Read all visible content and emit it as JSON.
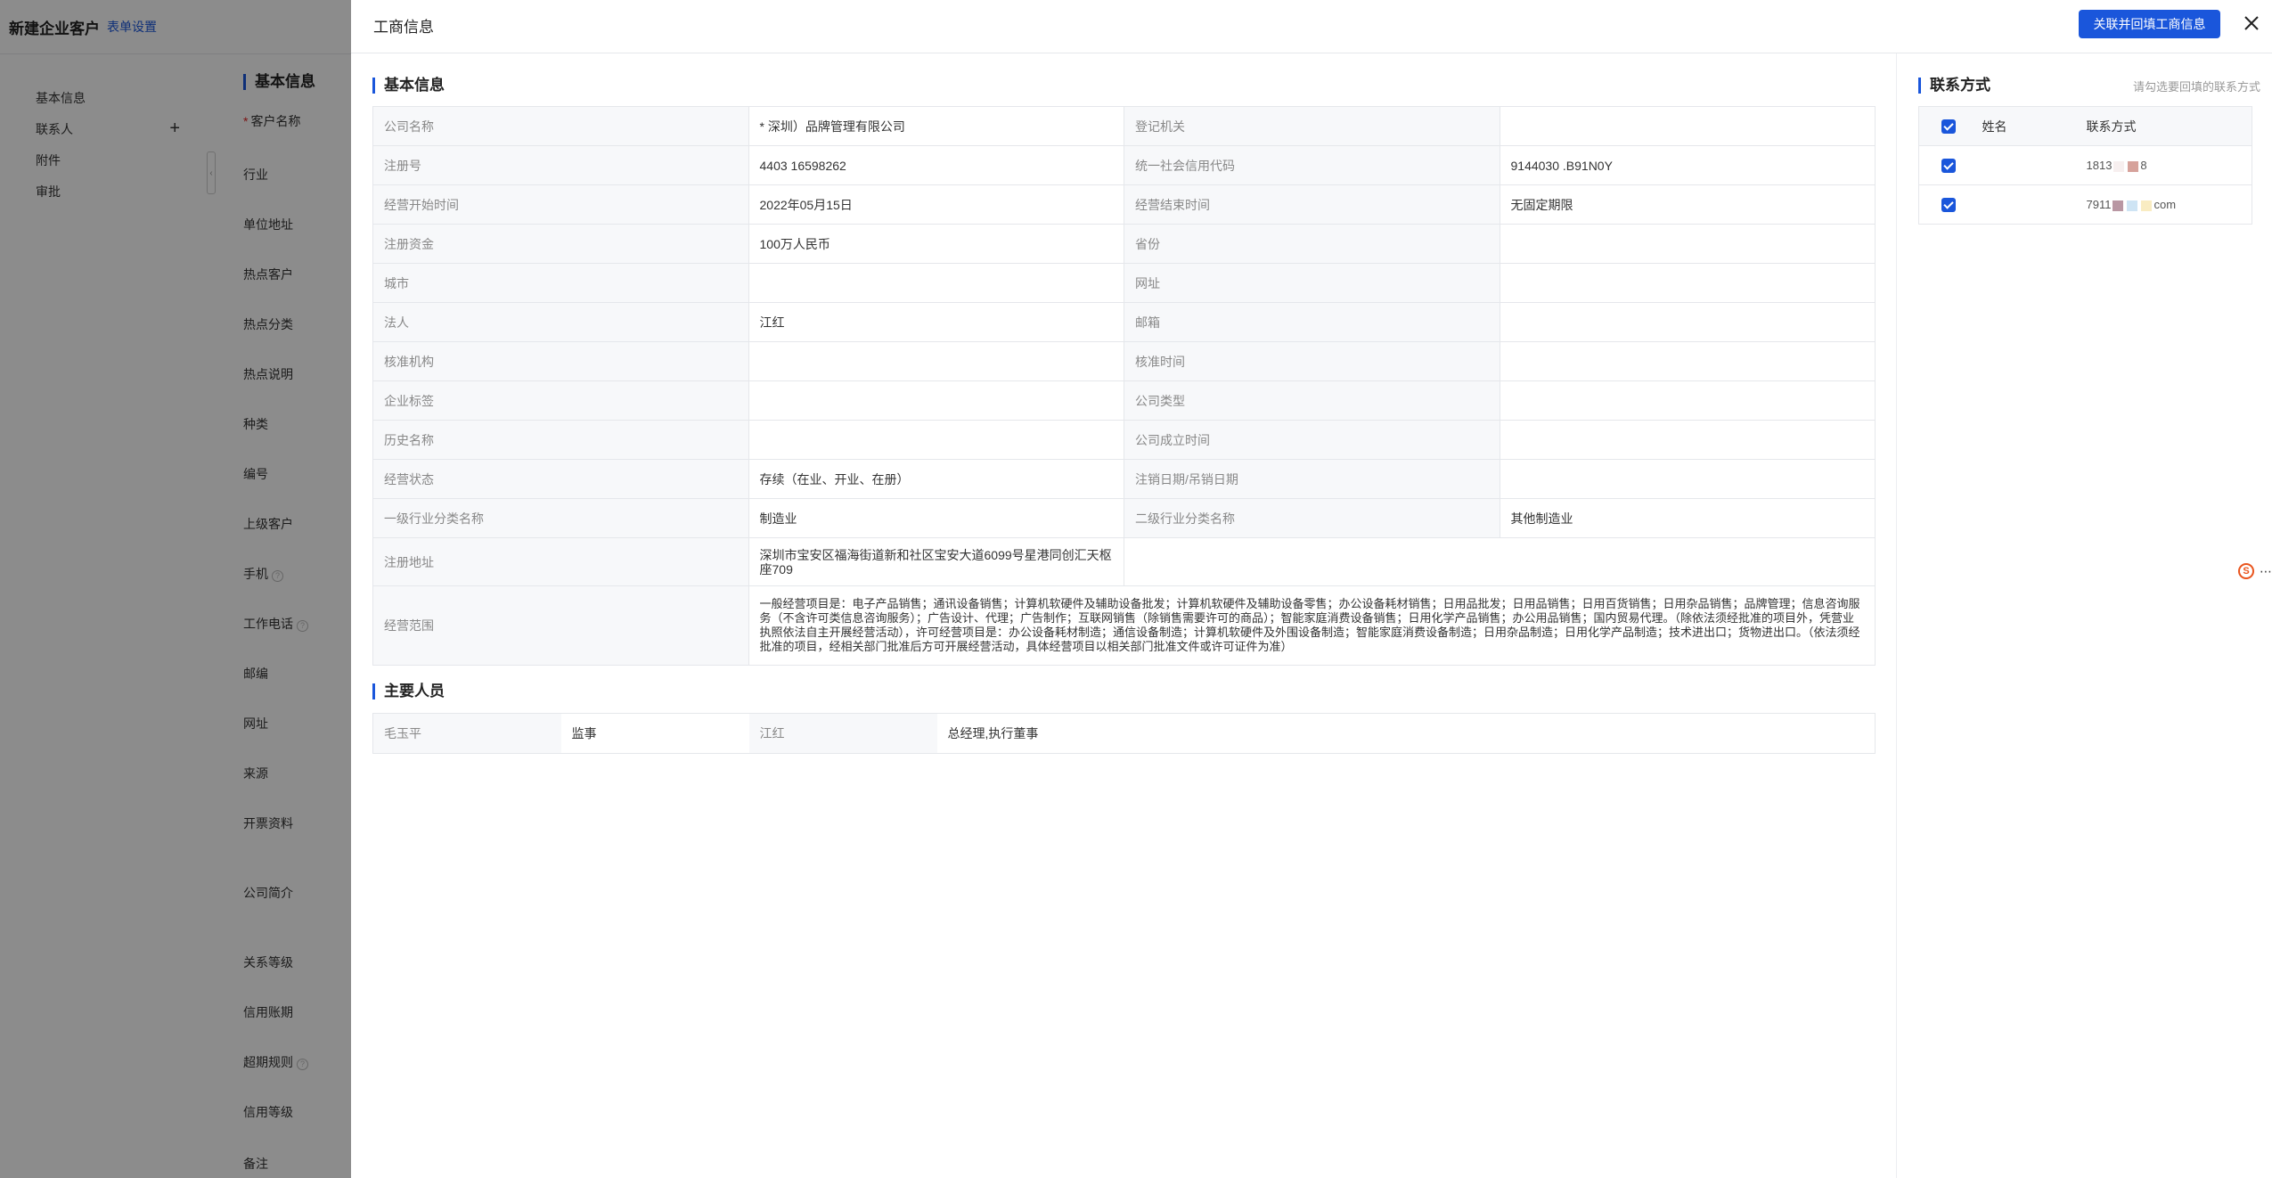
{
  "background_page": {
    "title": "新建企业客户",
    "form_settings_link": "表单设置",
    "nav": [
      "基本信息",
      "联系人",
      "附件",
      "审批"
    ],
    "section_title": "基本信息",
    "fields": [
      "客户名称",
      "行业",
      "单位地址",
      "热点客户",
      "热点分类",
      "热点说明",
      "种类",
      "编号",
      "上级客户",
      "手机",
      "工作电话",
      "邮编",
      "网址",
      "来源",
      "开票资料",
      "公司简介",
      "关系等级",
      "信用账期",
      "超期规则",
      "信用等级",
      "备注"
    ]
  },
  "drawer": {
    "title": "工商信息",
    "primary_button": "关联并回填工商信息",
    "basic_section_title": "基本信息",
    "basic_rows": [
      {
        "l1": "公司名称",
        "v1": "*    深圳）品牌管理有限公司",
        "l2": "登记机关",
        "v2": ""
      },
      {
        "l1": "注册号",
        "v1": "4403    16598262",
        "l2": "统一社会信用代码",
        "v2": "9144030   .B91N0Y"
      },
      {
        "l1": "经营开始时间",
        "v1": "2022年05月15日",
        "l2": "经营结束时间",
        "v2": "无固定期限"
      },
      {
        "l1": "注册资金",
        "v1": "100万人民币",
        "l2": "省份",
        "v2": ""
      },
      {
        "l1": "城市",
        "v1": "",
        "l2": "网址",
        "v2": ""
      },
      {
        "l1": "法人",
        "v1": "江红",
        "l2": "邮箱",
        "v2": ""
      },
      {
        "l1": "核准机构",
        "v1": "",
        "l2": "核准时间",
        "v2": ""
      },
      {
        "l1": "企业标签",
        "v1": "",
        "l2": "公司类型",
        "v2": ""
      },
      {
        "l1": "历史名称",
        "v1": "",
        "l2": "公司成立时间",
        "v2": ""
      },
      {
        "l1": "经营状态",
        "v1": "存续（在业、开业、在册）",
        "l2": "注销日期/吊销日期",
        "v2": ""
      },
      {
        "l1": "一级行业分类名称",
        "v1": "制造业",
        "l2": "二级行业分类名称",
        "v2": "其他制造业"
      }
    ],
    "address_label": "注册地址",
    "address_value": "深圳市宝安区福海街道新和社区宝安大道6099号星港同创汇天枢座709",
    "scope_label": "经营范围",
    "scope_value": "一般经营项目是：电子产品销售；通讯设备销售；计算机软硬件及辅助设备批发；计算机软硬件及辅助设备零售；办公设备耗材销售；日用品批发；日用品销售；日用百货销售；日用杂品销售；品牌管理；信息咨询服务（不含许可类信息咨询服务）；广告设计、代理；广告制作；互联网销售（除销售需要许可的商品）；智能家庭消费设备销售；日用化学产品销售；办公用品销售；国内贸易代理。（除依法须经批准的项目外，凭营业执照依法自主开展经营活动），许可经营项目是：办公设备耗材制造；通信设备制造；计算机软硬件及外围设备制造；智能家庭消费设备制造；日用杂品制造；日用化学产品制造；技术进出口；货物进出口。（依法须经批准的项目，经相关部门批准后方可开展经营活动，具体经营项目以相关部门批准文件或许可证件为准）",
    "people_section_title": "主要人员",
    "people": [
      {
        "name": "毛玉平",
        "role": "监事"
      },
      {
        "name": "江红",
        "role": "总经理,执行董事"
      }
    ],
    "contact_section_title": "联系方式",
    "contact_hint": "请勾选要回填的联系方式",
    "contact_headers": [
      "姓名",
      "联系方式"
    ],
    "contacts": [
      {
        "name": "",
        "value_start": "1813",
        "value_end": "8"
      },
      {
        "name": "",
        "value_start": "7911",
        "value_end": "com"
      }
    ]
  },
  "colors": {
    "accent": "#1a56db",
    "overlay": "rgba(0,0,0,0.45)"
  }
}
